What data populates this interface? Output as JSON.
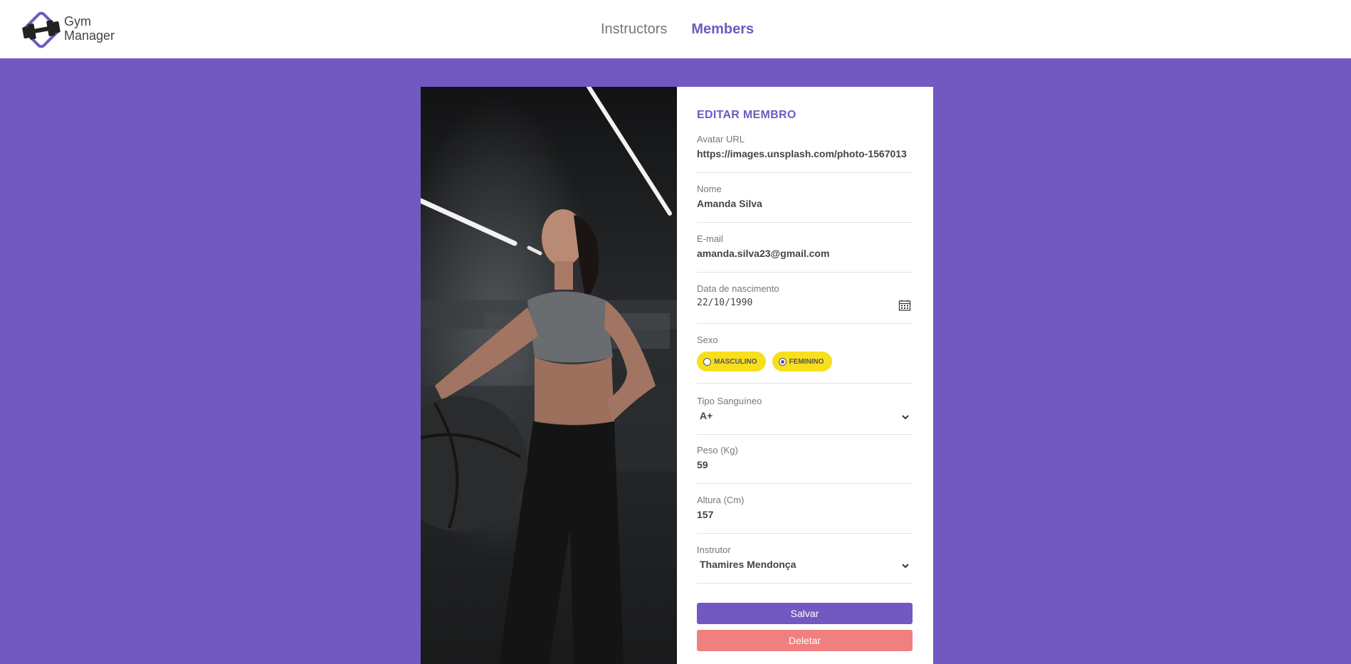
{
  "header": {
    "logo_line1": "Gym",
    "logo_line2": "Manager",
    "nav": [
      {
        "label": "Instructors",
        "active": false
      },
      {
        "label": "Members",
        "active": true
      }
    ]
  },
  "form": {
    "title": "EDITAR MEMBRO",
    "avatar": {
      "label": "Avatar URL",
      "value": "https://images.unsplash.com/photo-1567013"
    },
    "name": {
      "label": "Nome",
      "value": "Amanda Silva"
    },
    "email": {
      "label": "E-mail",
      "value": "amanda.silva23@gmail.com"
    },
    "birth": {
      "label": "Data de nascimento",
      "value": "22/10/1990",
      "icon": "calendar-icon"
    },
    "gender": {
      "label": "Sexo",
      "options": [
        {
          "label": "MASCULINO",
          "selected": false
        },
        {
          "label": "FEMININO",
          "selected": true
        }
      ]
    },
    "blood": {
      "label": "Tipo Sanguíneo",
      "value": "A+",
      "icon": "chevron-down-icon"
    },
    "weight": {
      "label": "Peso (Kg)",
      "value": "59"
    },
    "height": {
      "label": "Altura (Cm)",
      "value": "157"
    },
    "instructor": {
      "label": "Instrutor",
      "value": "Thamires Mendonça",
      "icon": "chevron-down-icon"
    },
    "save_label": "Salvar",
    "delete_label": "Deletar"
  },
  "colors": {
    "brand": "#7159c1",
    "pill": "#f7df1e",
    "delete": "#f07f7f"
  }
}
